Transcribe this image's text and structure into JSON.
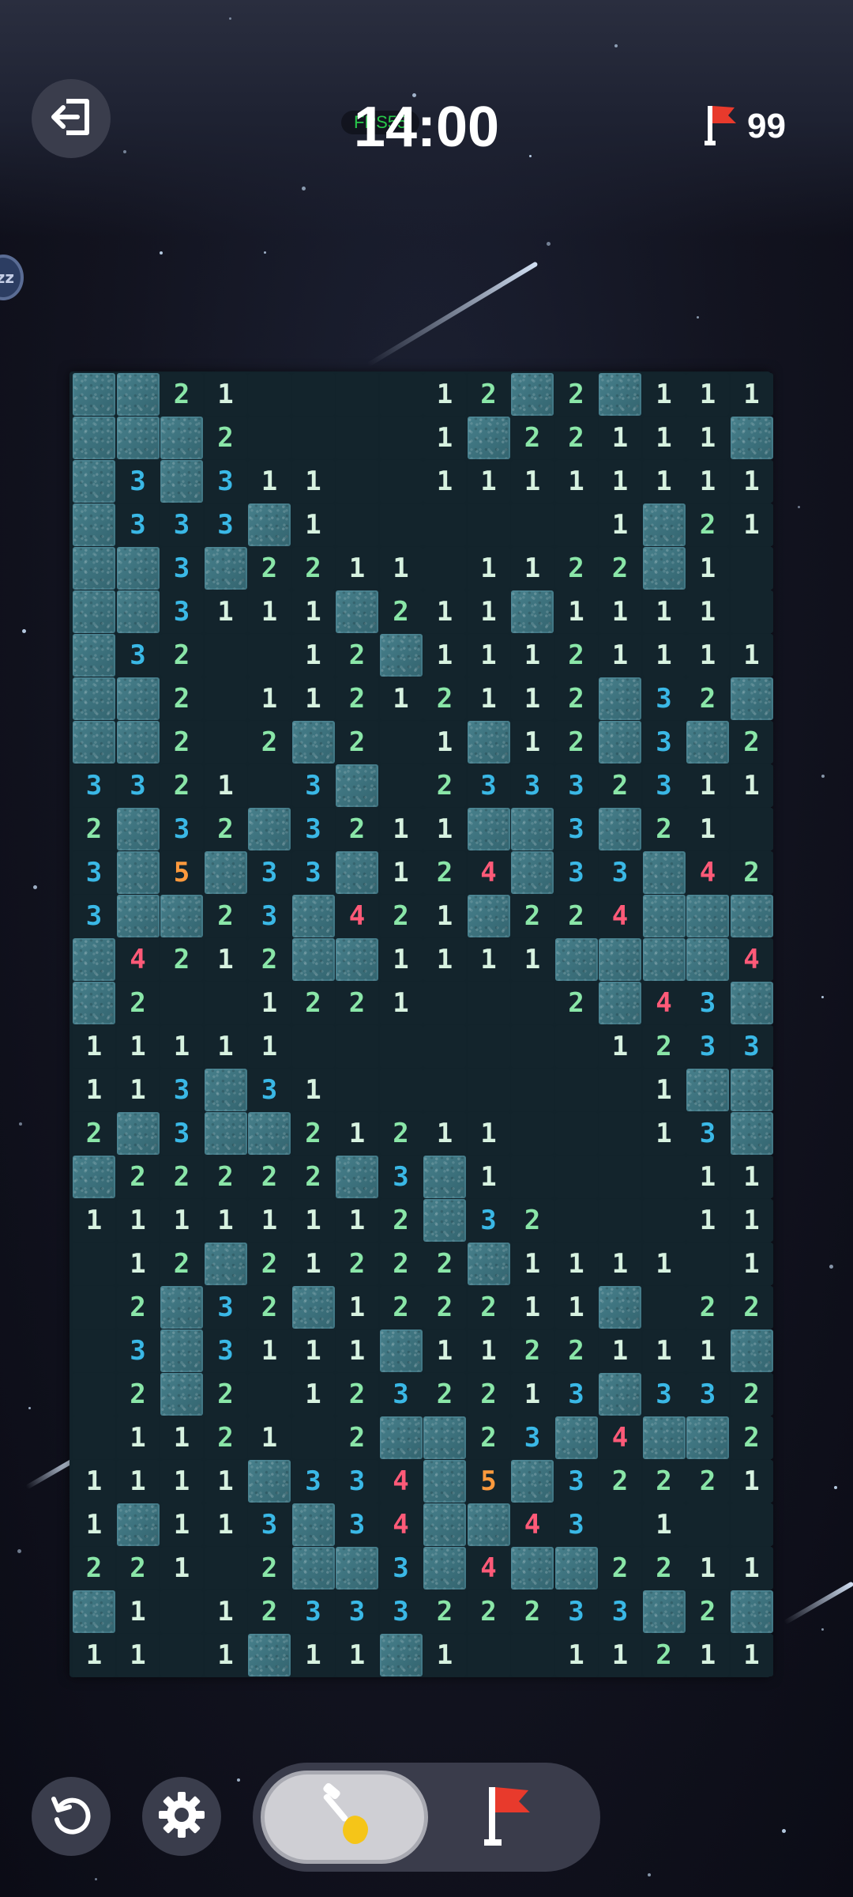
{
  "header": {
    "timer": "14:00",
    "fps_label": "FPS55",
    "flags_remaining": "99",
    "side_badge": "zz"
  },
  "icons": {
    "exit": "exit-icon",
    "flag": "flag-icon",
    "undo": "undo-icon",
    "settings": "gear-icon",
    "shovel": "shovel-icon"
  },
  "colors": {
    "n1": "#d7f2e0",
    "n2": "#8ae6a8",
    "n3": "#3ab8e6",
    "n4": "#ff5a78",
    "n5": "#ff9a3d",
    "flag_red": "#e83a2c"
  },
  "board": {
    "columns": 16,
    "legend": "H = covered tile, . = revealed empty, digit = revealed number",
    "rows": [
      "HH21....12H2H111",
      "HHH2....1H22111H",
      "H3H311..11111111",
      "H333H1......1H21",
      "HH3H2211.1122H1.",
      "HH3111H211H1111.",
      "H32..12H11121111",
      "HH2.11212112H32H",
      "HH2.2H2.1H12H3H2",
      "3321.3H.23332311",
      "2H32H3211HH3H21.",
      "3H5H33H124H33H42",
      "3HH23H421H224HHH",
      "H4212HH1111HHHH4",
      "H2..1221...2H43H",
      "11111.......1233",
      "113H31.......1HH",
      "2H3HH21211...13H",
      "H22222H3H1....11",
      "11111112H32...11",
      ".12H21222H1111.1",
      ".2H32H122211H.22",
      ".3H3111H1122111H",
      ".2H2.1232213H332",
      ".1121.2HH23H4HH2H",
      "1111H334H5H32221",
      "1H113H34HH43.1..",
      "221.2HH3H4HH2211",
      "H1.1233322233H2H1",
      "11.1H11H1..112111"
    ]
  }
}
